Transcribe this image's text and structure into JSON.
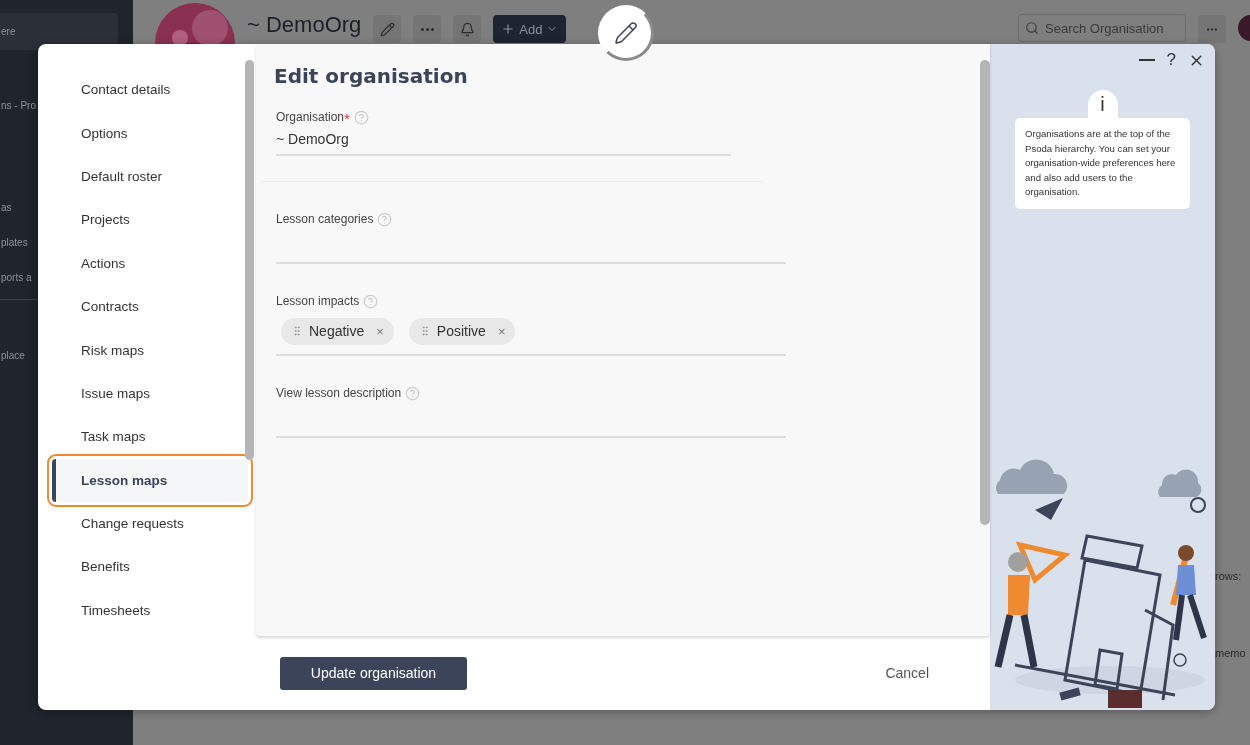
{
  "background": {
    "sidebar": [
      {
        "kind": "field",
        "text": "ere"
      },
      {
        "kind": "item",
        "text": "ns - Pro"
      },
      {
        "kind": "item",
        "text": "as"
      },
      {
        "kind": "item",
        "text": "plates"
      },
      {
        "kind": "item",
        "text": "ports a"
      },
      {
        "kind": "divider"
      },
      {
        "kind": "item",
        "text": "place"
      }
    ],
    "header": {
      "title": "~ DemoOrg",
      "add_button": "Add",
      "search": {
        "placeholder": "Search Organisation"
      }
    },
    "right_fragments": [
      "rows:",
      "memo"
    ]
  },
  "dialog": {
    "nav_items": [
      {
        "label": "Contact details",
        "selected": false
      },
      {
        "label": "Options",
        "selected": false
      },
      {
        "label": "Default roster",
        "selected": false
      },
      {
        "label": "Projects",
        "selected": false
      },
      {
        "label": "Actions",
        "selected": false
      },
      {
        "label": "Contracts",
        "selected": false
      },
      {
        "label": "Risk maps",
        "selected": false
      },
      {
        "label": "Issue maps",
        "selected": false
      },
      {
        "label": "Task maps",
        "selected": false
      },
      {
        "label": "Lesson maps",
        "selected": true
      },
      {
        "label": "Change requests",
        "selected": false
      },
      {
        "label": "Benefits",
        "selected": false
      },
      {
        "label": "Timesheets",
        "selected": false
      }
    ],
    "title": "Edit organisation",
    "fields": [
      {
        "kind": "text",
        "label": "Organisation",
        "required_mark": "*",
        "value": "~ DemoOrg"
      },
      {
        "kind": "text",
        "label": "Lesson categories"
      },
      {
        "kind": "tags",
        "label": "Lesson impacts",
        "tags": [
          {
            "label": "Negative",
            "remove": "×"
          },
          {
            "label": "Positive",
            "remove": "×"
          }
        ]
      },
      {
        "kind": "text",
        "label": "View lesson description"
      }
    ],
    "primary_button": "Update organisation",
    "cancel_button": "Cancel",
    "window_help": "?",
    "info": {
      "mark": "i",
      "text": "Organisations are at the top of the Psoda hierarchy. You can set your organisation-wide preferences here and also add users to the organisation."
    }
  }
}
